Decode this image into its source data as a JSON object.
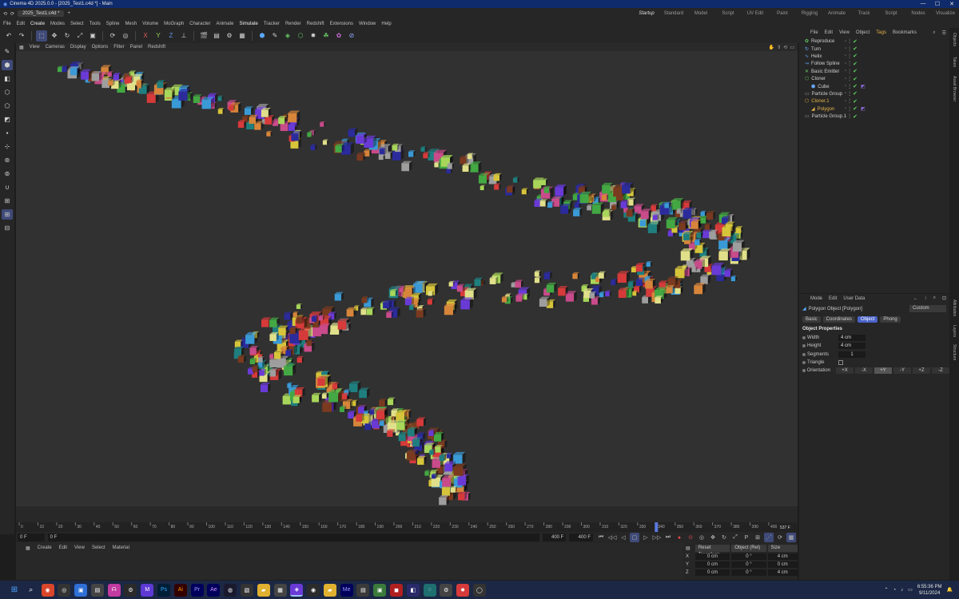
{
  "window": {
    "title": "Cinema 4D 2025.0.0 - [2025_Test1.c4d *] - Main",
    "doc_tab": "2025_Test1.c4d *"
  },
  "layouts": [
    "Startup",
    "Standard",
    "Model",
    "Script",
    "UV Edit",
    "Paint",
    "Rigging",
    "Animate",
    "Track",
    "Script",
    "Nodes",
    "Visualize"
  ],
  "menu": [
    "File",
    "Edit",
    "Create",
    "Modes",
    "Select",
    "Tools",
    "Spline",
    "Mesh",
    "Volume",
    "MoGraph",
    "Character",
    "Animate",
    "Simulate",
    "Tracker",
    "Render",
    "Redshift",
    "Extensions",
    "Window",
    "Help"
  ],
  "viewport_menu": [
    "View",
    "Cameras",
    "Display",
    "Options",
    "Filter",
    "Panel",
    "Redshift"
  ],
  "axis_toggles": [
    "X",
    "Y",
    "Z"
  ],
  "object_manager": {
    "menu": [
      "File",
      "Edit",
      "View",
      "Object",
      "Tags",
      "Bookmarks"
    ],
    "objects": [
      {
        "name": "Reproduce",
        "icon": "mograph-icon",
        "color": "#66cc66",
        "has_tag": false
      },
      {
        "name": "Turn",
        "icon": "deformer-icon",
        "color": "#66aaff",
        "has_tag": false
      },
      {
        "name": "Helix",
        "icon": "spline-icon",
        "color": "#66aaff",
        "has_tag": false
      },
      {
        "name": "Follow Spline",
        "icon": "follow-icon",
        "color": "#66aaff",
        "has_tag": false
      },
      {
        "name": "Basic Emitter",
        "icon": "emitter-icon",
        "color": "#66cc66",
        "has_tag": false
      },
      {
        "name": "Cloner",
        "icon": "cloner-icon",
        "color": "#66cc66",
        "has_tag": false
      },
      {
        "name": "Cube",
        "icon": "cube-icon",
        "color": "#66aaff",
        "has_tag": true
      },
      {
        "name": "Particle Group",
        "icon": "folder-icon",
        "color": "#aaaaaa",
        "has_tag": false
      },
      {
        "name": "Cloner.1",
        "icon": "cloner-icon",
        "color": "#e3b34b",
        "has_tag": false
      },
      {
        "name": "Polygon",
        "icon": "polygon-icon",
        "color": "#e3b34b",
        "has_tag": true
      },
      {
        "name": "Particle Group.1",
        "icon": "folder-icon",
        "color": "#aaaaaa",
        "has_tag": false
      }
    ]
  },
  "attributes": {
    "menu": [
      "Mode",
      "Edit",
      "User Data"
    ],
    "object_title": "Polygon Object [Polygon]",
    "preset": "Custom",
    "tabs": [
      "Basic",
      "Coordinates",
      "Object",
      "Phong"
    ],
    "active_tab": "Object",
    "section": "Object Properties",
    "props": {
      "width_label": "Width",
      "width": "4 cm",
      "height_label": "Height",
      "height": "4 cm",
      "segments_label": "Segments",
      "segments": "1",
      "triangle_label": "Triangle",
      "orientation_label": "Orientation"
    },
    "orientation": [
      "+X",
      "-X",
      "+Y",
      "-Y",
      "+Z",
      "-Z"
    ],
    "orientation_active": "+Y"
  },
  "timeline": {
    "ticks": [
      "0",
      "10",
      "20",
      "30",
      "40",
      "50",
      "60",
      "70",
      "80",
      "90",
      "100",
      "110",
      "120",
      "130",
      "140",
      "150",
      "160",
      "170",
      "180",
      "190",
      "200",
      "210",
      "220",
      "230",
      "240",
      "250",
      "260",
      "270",
      "280",
      "290",
      "300",
      "310",
      "320",
      "330",
      "340",
      "350",
      "360",
      "370",
      "380",
      "390",
      "400"
    ],
    "current_frame": "537 F",
    "playhead_frame": 340,
    "start_frame": "0 F",
    "min_field": "0 F",
    "end_field": "400 F",
    "max_field": "400 F"
  },
  "bottom_menu": [
    "Create",
    "Edit",
    "View",
    "Select",
    "Material"
  ],
  "coordinates": {
    "reset_label": "Reset Transform",
    "space": "Object (Rel)",
    "size_mode": "Size",
    "rows": [
      {
        "axis": "X",
        "pos": "0 cm",
        "rot": "0 °",
        "size": "4 cm"
      },
      {
        "axis": "Y",
        "pos": "0 cm",
        "rot": "0 °",
        "size": "0 cm"
      },
      {
        "axis": "Z",
        "pos": "0 cm",
        "rot": "0 °",
        "size": "4 cm"
      }
    ]
  },
  "right_tabs": [
    "Objects",
    "Takes",
    "Asset Browser",
    "Attributes",
    "Layers",
    "Structure"
  ],
  "taskbar": {
    "time": "6:55:36 PM",
    "date": "9/11/2024"
  },
  "scene": {
    "cube_colors": [
      "#d63a3a",
      "#3a9ad6",
      "#d6c43a",
      "#43a843",
      "#6a3ad6",
      "#d6853a",
      "#2b2b9c",
      "#c84b8a",
      "#a8d65a",
      "#9e9e9e",
      "#1f7f7f",
      "#e0e08a",
      "#7a3a1f"
    ]
  }
}
